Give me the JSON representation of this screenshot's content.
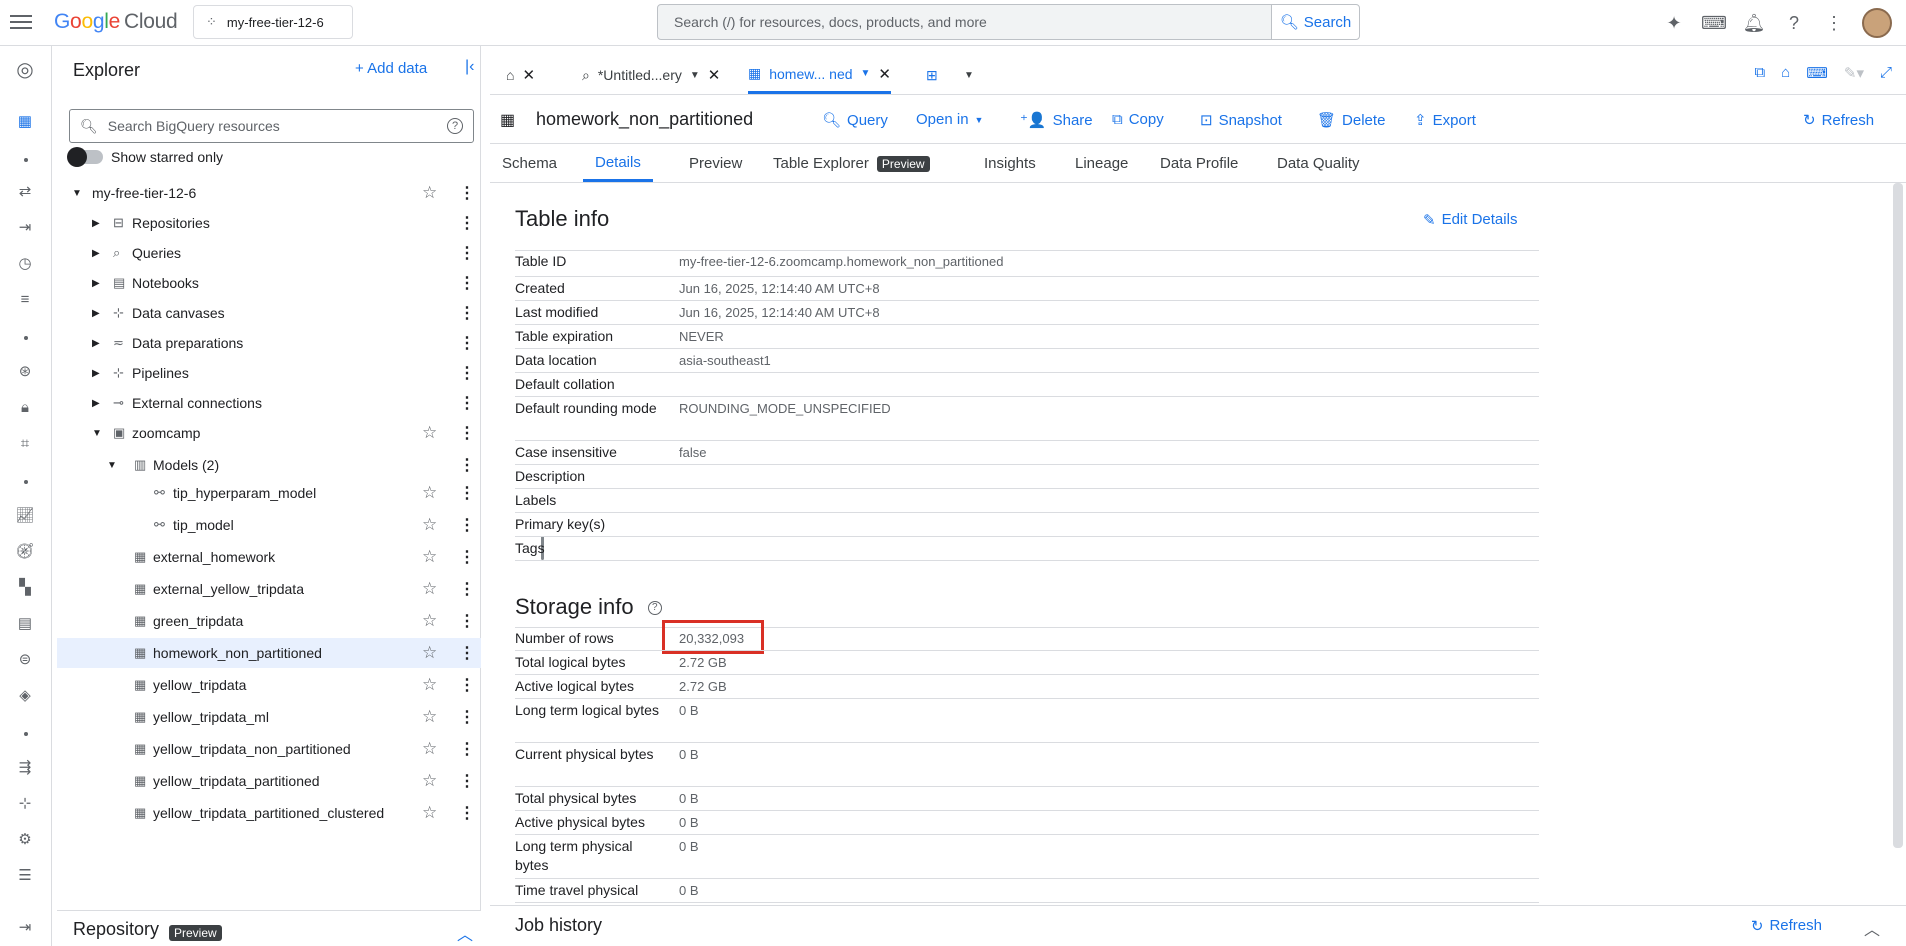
{
  "brand": {
    "google": "Google",
    "cloud": "Cloud"
  },
  "project_selector": {
    "label": "my-free-tier-12-6"
  },
  "search": {
    "placeholder": "Search (/) for resources, docs, products, and more",
    "button": "Search"
  },
  "explorer": {
    "title": "Explorer",
    "add_data": "Add data",
    "search_placeholder": "Search BigQuery resources",
    "starred_only": "Show starred only",
    "tree": [
      {
        "label": "my-free-tier-12-6",
        "level": 0,
        "caret": "down",
        "icon": "none",
        "star": true
      },
      {
        "label": "Repositories",
        "level": 1,
        "caret": "right",
        "icon": "repo-icon"
      },
      {
        "label": "Queries",
        "level": 1,
        "caret": "right",
        "icon": "query-icon"
      },
      {
        "label": "Notebooks",
        "level": 1,
        "caret": "right",
        "icon": "notebook-icon"
      },
      {
        "label": "Data canvases",
        "level": 1,
        "caret": "right",
        "icon": "canvas-icon"
      },
      {
        "label": "Data preparations",
        "level": 1,
        "caret": "right",
        "icon": "dataprep-icon"
      },
      {
        "label": "Pipelines",
        "level": 1,
        "caret": "right",
        "icon": "pipeline-icon"
      },
      {
        "label": "External connections",
        "level": 1,
        "caret": "right",
        "icon": "connection-icon"
      },
      {
        "label": "zoomcamp",
        "level": 1,
        "caret": "down",
        "icon": "dataset-icon",
        "star": true
      },
      {
        "label": "Models (2)",
        "level": 2,
        "caret": "down",
        "icon": "models-icon"
      },
      {
        "label": "tip_hyperparam_model",
        "level": 3,
        "caret": "none",
        "icon": "model-icon",
        "star": true
      },
      {
        "label": "tip_model",
        "level": 3,
        "caret": "none",
        "icon": "model-icon",
        "star": true
      },
      {
        "label": "external_homework",
        "level": 2,
        "caret": "none",
        "icon": "table-icon",
        "star": true
      },
      {
        "label": "external_yellow_tripdata",
        "level": 2,
        "caret": "none",
        "icon": "table-icon",
        "star": true
      },
      {
        "label": "green_tripdata",
        "level": 2,
        "caret": "none",
        "icon": "table-icon",
        "star": true
      },
      {
        "label": "homework_non_partitioned",
        "level": 2,
        "caret": "none",
        "icon": "table-icon",
        "star": true,
        "selected": true
      },
      {
        "label": "yellow_tripdata",
        "level": 2,
        "caret": "none",
        "icon": "table-icon",
        "star": true
      },
      {
        "label": "yellow_tripdata_ml",
        "level": 2,
        "caret": "none",
        "icon": "table-icon",
        "star": true
      },
      {
        "label": "yellow_tripdata_non_partitioned",
        "level": 2,
        "caret": "none",
        "icon": "table-icon",
        "star": true
      },
      {
        "label": "yellow_tripdata_partitioned",
        "level": 2,
        "caret": "none",
        "icon": "table-icon",
        "star": true
      },
      {
        "label": "yellow_tripdata_partitioned_clustered",
        "level": 2,
        "caret": "none",
        "icon": "table-icon",
        "star": true
      }
    ],
    "repository": {
      "title": "Repository",
      "badge": "Preview"
    }
  },
  "tabs": [
    {
      "label": "",
      "icon": "home-icon"
    },
    {
      "label": "*Untitled...ery",
      "icon": "query-icon"
    },
    {
      "label": "homew... ned",
      "icon": "table-icon",
      "active": true
    }
  ],
  "table": {
    "name": "homework_non_partitioned",
    "actions": [
      "Query",
      "Open in",
      "Share",
      "Copy",
      "Snapshot",
      "Delete",
      "Export"
    ],
    "refresh": "Refresh"
  },
  "subtabs": [
    "Schema",
    "Details",
    "Preview",
    "Table Explorer",
    "Insights",
    "Lineage",
    "Data Profile",
    "Data Quality"
  ],
  "subtab_badge": "Preview",
  "table_info": {
    "title": "Table info",
    "edit": "Edit Details",
    "rows": [
      {
        "key": "Table ID",
        "value": "my-free-tier-12-6.zoomcamp.homework_non_partitioned"
      },
      {
        "key": "Created",
        "value": "Jun 16, 2025, 12:14:40 AM UTC+8"
      },
      {
        "key": "Last modified",
        "value": "Jun 16, 2025, 12:14:40 AM UTC+8"
      },
      {
        "key": "Table expiration",
        "value": "NEVER"
      },
      {
        "key": "Data location",
        "value": "asia-southeast1"
      },
      {
        "key": "Default collation",
        "value": ""
      },
      {
        "key": "Default rounding mode",
        "value": "ROUNDING_MODE_UNSPECIFIED"
      },
      {
        "key": "Case insensitive",
        "value": "false"
      },
      {
        "key": "Description",
        "value": ""
      },
      {
        "key": "Labels",
        "value": ""
      },
      {
        "key": "Primary key(s)",
        "value": ""
      },
      {
        "key": "Tags",
        "value": ""
      }
    ]
  },
  "storage_info": {
    "title": "Storage info",
    "rows": [
      {
        "key": "Number of rows",
        "value": "20,332,093"
      },
      {
        "key": "Total logical bytes",
        "value": "2.72 GB"
      },
      {
        "key": "Active logical bytes",
        "value": "2.72 GB"
      },
      {
        "key": "Long term logical bytes",
        "value": "0 B"
      },
      {
        "key": "Current physical bytes",
        "value": "0 B"
      },
      {
        "key": "Total physical bytes",
        "value": "0 B"
      },
      {
        "key": "Active physical bytes",
        "value": "0 B"
      },
      {
        "key": "Long term physical bytes",
        "value": "0 B"
      },
      {
        "key": "Time travel physical",
        "value": "0 B"
      }
    ]
  },
  "job_history": {
    "title": "Job history",
    "refresh": "Refresh"
  },
  "colors": {
    "accent": "#1a73e8",
    "highlight": "#d93025",
    "selected_row": "#e8f0fe"
  }
}
